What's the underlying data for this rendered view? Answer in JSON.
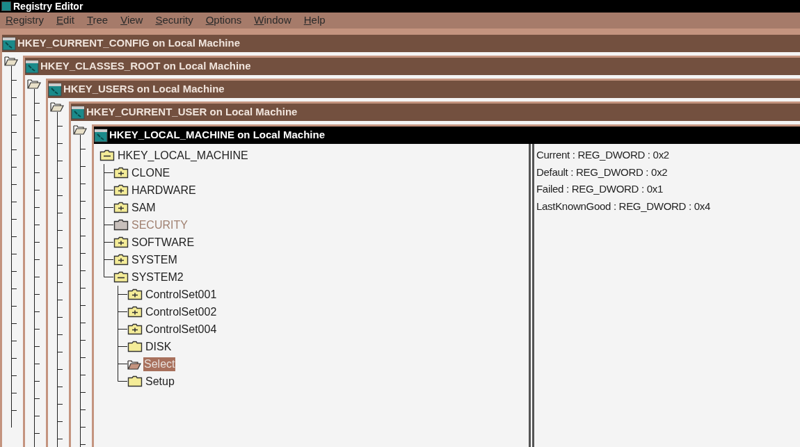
{
  "app_title": "Registry Editor",
  "menu": [
    {
      "label": "Registry"
    },
    {
      "label": "Edit"
    },
    {
      "label": "Tree"
    },
    {
      "label": "View"
    },
    {
      "label": "Security"
    },
    {
      "label": "Options"
    },
    {
      "label": "Window"
    },
    {
      "label": "Help"
    }
  ],
  "windows": [
    {
      "title": "HKEY_CURRENT_CONFIG on Local Machine",
      "active": false
    },
    {
      "title": "HKEY_CLASSES_ROOT on Local Machine",
      "active": false
    },
    {
      "title": "HKEY_USERS on Local Machine",
      "active": false
    },
    {
      "title": "HKEY_CURRENT_USER on Local Machine",
      "active": false
    },
    {
      "title": "HKEY_LOCAL_MACHINE on Local Machine",
      "active": true
    }
  ],
  "tree": [
    {
      "label": "HKEY_LOCAL_MACHINE",
      "kind": "expanded",
      "disabled": false,
      "selected": false,
      "children": [
        {
          "label": "CLONE",
          "kind": "collapsed",
          "disabled": false,
          "selected": false
        },
        {
          "label": "HARDWARE",
          "kind": "collapsed",
          "disabled": false,
          "selected": false
        },
        {
          "label": "SAM",
          "kind": "collapsed",
          "disabled": false,
          "selected": false
        },
        {
          "label": "SECURITY",
          "kind": "leaf",
          "disabled": true,
          "selected": false
        },
        {
          "label": "SOFTWARE",
          "kind": "collapsed",
          "disabled": false,
          "selected": false
        },
        {
          "label": "SYSTEM",
          "kind": "collapsed",
          "disabled": false,
          "selected": false
        },
        {
          "label": "SYSTEM2",
          "kind": "expanded",
          "disabled": false,
          "selected": false,
          "children": [
            {
              "label": "ControlSet001",
              "kind": "collapsed",
              "disabled": false,
              "selected": false
            },
            {
              "label": "ControlSet002",
              "kind": "collapsed",
              "disabled": false,
              "selected": false
            },
            {
              "label": "ControlSet004",
              "kind": "collapsed",
              "disabled": false,
              "selected": false
            },
            {
              "label": "DISK",
              "kind": "leaf",
              "disabled": false,
              "selected": false
            },
            {
              "label": "Select",
              "kind": "leaf",
              "disabled": false,
              "selected": true
            },
            {
              "label": "Setup",
              "kind": "leaf",
              "disabled": false,
              "selected": false
            }
          ]
        }
      ]
    }
  ],
  "values": [
    "Current : REG_DWORD : 0x2",
    "Default : REG_DWORD : 0x2",
    "Failed : REG_DWORD : 0x1",
    "LastKnownGood : REG_DWORD : 0x4"
  ]
}
